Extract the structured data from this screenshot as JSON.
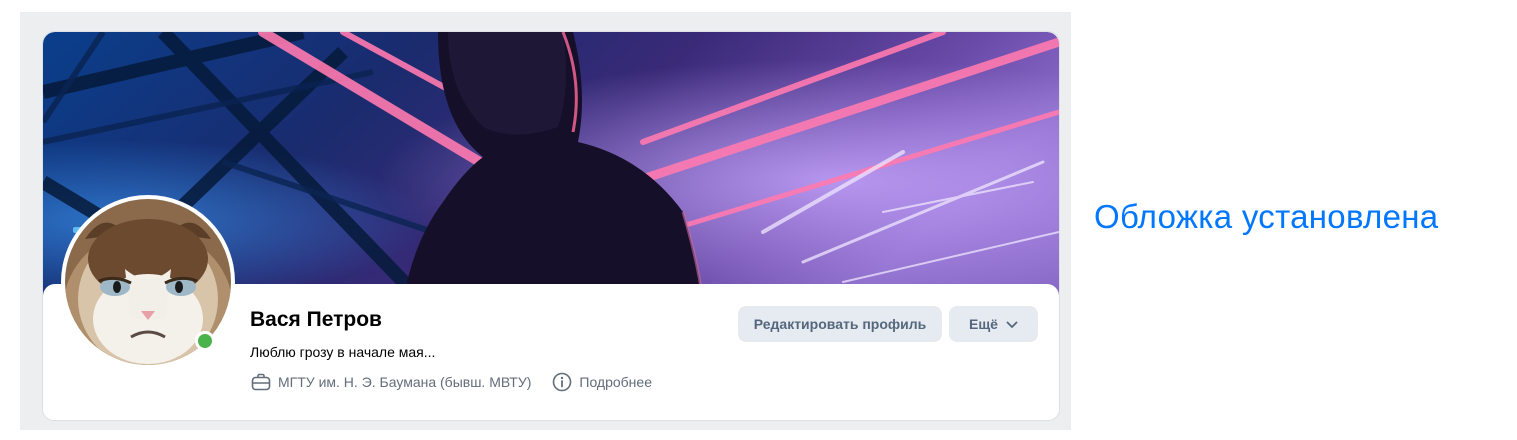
{
  "profile": {
    "name": "Вася Петров",
    "status": "Люблю грозу в начале мая...",
    "online": true,
    "education": "МГТУ им. Н. Э. Баумана (бывш. МВТУ)",
    "details_label": "Подробнее"
  },
  "actions": {
    "edit_label": "Редактировать профиль",
    "more_label": "Ещё"
  },
  "notice": {
    "text": "Обложка установлена"
  },
  "colors": {
    "accent": "#0077ff",
    "online": "#4bb34b",
    "button_bg": "#e5ebf1",
    "button_text": "#55677d",
    "page_bg": "#edeef0"
  },
  "icons": {
    "education": "briefcase-icon",
    "details": "info-icon",
    "more": "chevron-down-icon"
  }
}
